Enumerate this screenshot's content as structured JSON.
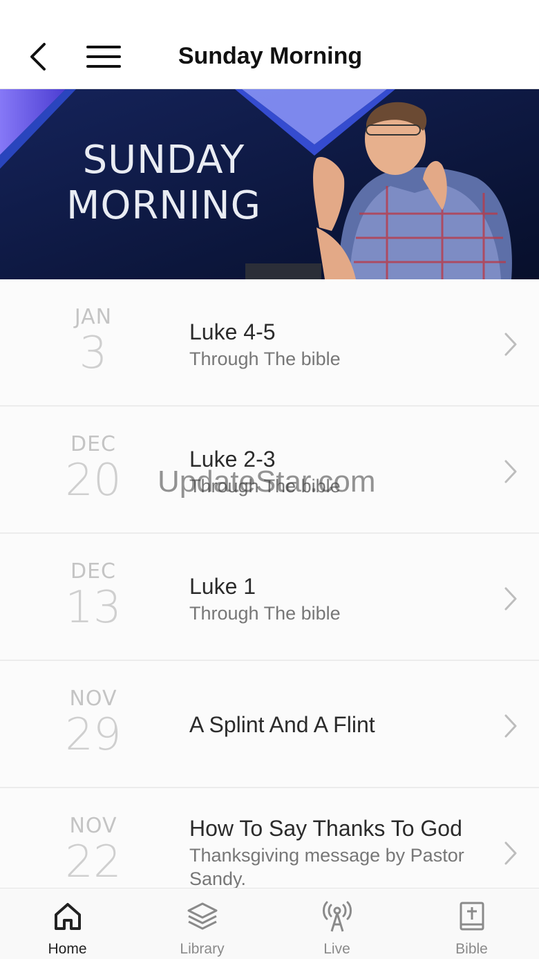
{
  "header": {
    "title": "Sunday Morning"
  },
  "banner": {
    "line1": "SUNDAY",
    "line2": "MORNING"
  },
  "sermons": [
    {
      "month": "JAN",
      "day": "3",
      "title": "Luke 4-5",
      "subtitle": "Through The bible"
    },
    {
      "month": "DEC",
      "day": "20",
      "title": "Luke 2-3",
      "subtitle": "Through The bible"
    },
    {
      "month": "DEC",
      "day": "13",
      "title": "Luke 1",
      "subtitle": "Through The bible"
    },
    {
      "month": "NOV",
      "day": "29",
      "title": "A Splint And A Flint",
      "subtitle": ""
    },
    {
      "month": "NOV",
      "day": "22",
      "title": "How To Say Thanks To God",
      "subtitle": "Thanksgiving message by Pastor Sandy."
    }
  ],
  "watermark": "UpdateStar.com",
  "tabs": [
    {
      "label": "Home",
      "icon": "home-icon",
      "active": true
    },
    {
      "label": "Library",
      "icon": "layers-icon",
      "active": false
    },
    {
      "label": "Live",
      "icon": "broadcast-icon",
      "active": false
    },
    {
      "label": "Bible",
      "icon": "bible-icon",
      "active": false
    }
  ],
  "colors": {
    "banner_bg": "#0a1538",
    "accent_purple": "#7b6cff",
    "muted_text": "#777777"
  }
}
